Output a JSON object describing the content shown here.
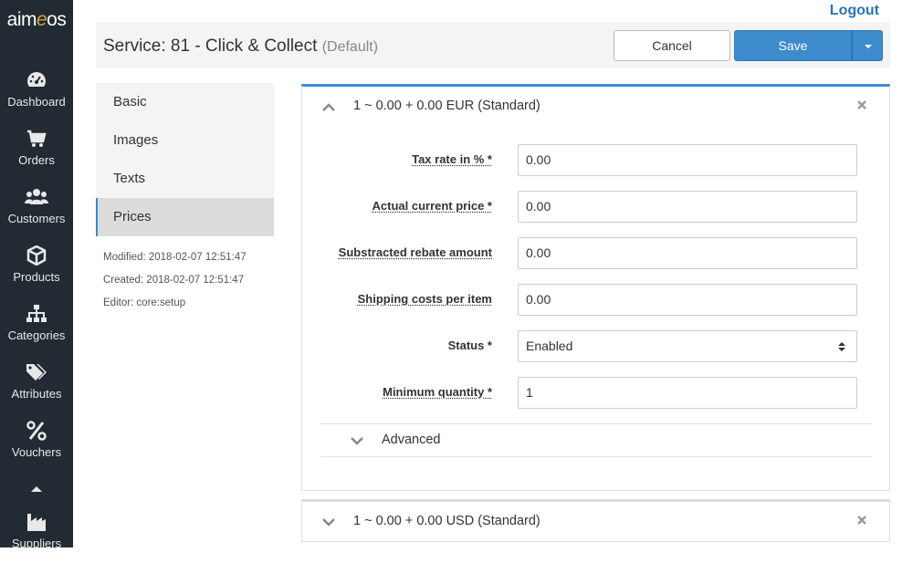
{
  "brand": {
    "logo_prefix": "aim",
    "logo_e": "e",
    "logo_suffix": "os"
  },
  "sidebar": {
    "items": [
      {
        "label": "Dashboard",
        "icon": "dashboard-icon"
      },
      {
        "label": "Orders",
        "icon": "cart-icon"
      },
      {
        "label": "Customers",
        "icon": "users-icon"
      },
      {
        "label": "Products",
        "icon": "cube-icon"
      },
      {
        "label": "Categories",
        "icon": "sitemap-icon"
      },
      {
        "label": "Attributes",
        "icon": "tags-icon"
      },
      {
        "label": "Vouchers",
        "icon": "percent-icon"
      },
      {
        "label": "Suppliers",
        "icon": "factory-icon"
      }
    ]
  },
  "top": {
    "logout": "Logout"
  },
  "header": {
    "title": "Service: 81 - Click & Collect",
    "default_tag": "(Default)",
    "cancel": "Cancel",
    "save": "Save"
  },
  "tabs": [
    {
      "label": "Basic"
    },
    {
      "label": "Images"
    },
    {
      "label": "Texts"
    },
    {
      "label": "Prices",
      "active": true
    }
  ],
  "meta": {
    "modified": "Modified: 2018-02-07 12:51:47",
    "created": "Created: 2018-02-07 12:51:47",
    "editor": "Editor: core:setup"
  },
  "price_items": [
    {
      "title": "1 ~ 0.00 + 0.00 EUR (Standard)",
      "expanded": true,
      "fields": [
        {
          "label": "Tax rate in % *",
          "value": "0.00"
        },
        {
          "label": "Actual current price *",
          "value": "0.00"
        },
        {
          "label": "Substracted rebate amount",
          "value": "0.00"
        },
        {
          "label": "Shipping costs per item",
          "value": "0.00"
        },
        {
          "label": "Status *",
          "value": "Enabled"
        },
        {
          "label": "Minimum quantity *",
          "value": "1"
        }
      ],
      "advanced": "Advanced"
    },
    {
      "title": "1 ~ 0.00 + 0.00 USD (Standard)",
      "expanded": false
    }
  ],
  "colors": {
    "accent": "#3d8bcd",
    "sidebar": "#222b33",
    "link": "#2a74b5"
  }
}
